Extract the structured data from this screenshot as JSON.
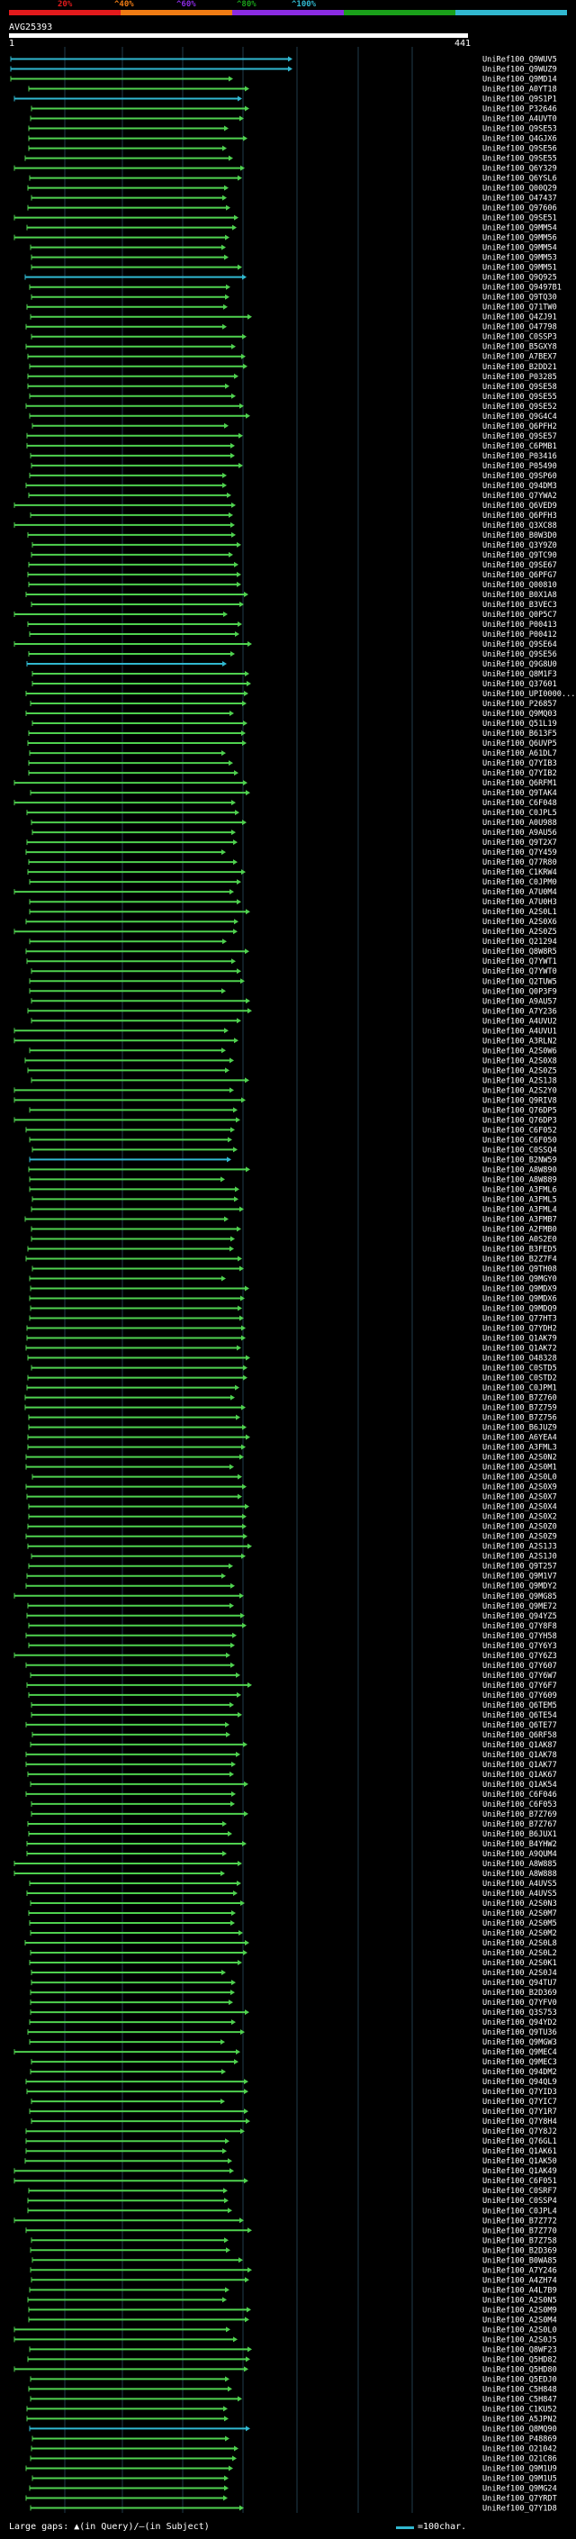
{
  "header": {
    "percent_ticks": [
      "20%",
      "^40%",
      "^60%",
      "^80%",
      "^100%"
    ],
    "bar_colors": [
      "#e31a1c",
      "#f07c14",
      "#8a2be2",
      "#1aa01a",
      "#31b8d0"
    ],
    "query_id": "AVG25393",
    "scale_start": "1",
    "scale_end": "441"
  },
  "colors": {
    "hit_green": "#4fd14f",
    "hit_cyan": "#31b8d0",
    "grid": "#1f3c4d",
    "gap": "#2a7a2a"
  },
  "hits": [
    {
      "id": "UniRef100_Q9WUV5",
      "color": "cyan"
    },
    {
      "id": "UniRef100_Q9WUZ9",
      "color": "cyan"
    },
    {
      "id": "UniRef100_Q9MD14",
      "color": "green"
    },
    {
      "id": "UniRef100_A0YT18",
      "color": "green"
    },
    {
      "id": "UniRef100_Q9S1P1",
      "color": "cyan"
    },
    {
      "id": "UniRef100_P32646",
      "color": "green"
    },
    {
      "id": "UniRef100_A4UVT0",
      "color": "green"
    },
    {
      "id": "UniRef100_Q9SE53",
      "color": "green"
    },
    {
      "id": "UniRef100_Q4GJX6",
      "color": "green"
    },
    {
      "id": "UniRef100_Q9SE56",
      "color": "green"
    },
    {
      "id": "UniRef100_Q9SE55",
      "color": "green"
    },
    {
      "id": "UniRef100_Q6Y329",
      "color": "green"
    },
    {
      "id": "UniRef100_Q6YSL6",
      "color": "green"
    },
    {
      "id": "UniRef100_Q00Q29",
      "color": "green"
    },
    {
      "id": "UniRef100_O47437",
      "color": "green"
    },
    {
      "id": "UniRef100_Q97606",
      "color": "green"
    },
    {
      "id": "UniRef100_Q9SE51",
      "color": "green"
    },
    {
      "id": "UniRef100_Q9MM54",
      "color": "green"
    },
    {
      "id": "UniRef100_Q9MM56",
      "color": "green"
    },
    {
      "id": "UniRef100_Q9MM54",
      "color": "green"
    },
    {
      "id": "UniRef100_Q9MM53",
      "color": "green"
    },
    {
      "id": "UniRef100_Q9MM51",
      "color": "green"
    },
    {
      "id": "UniRef100_Q9Q925",
      "color": "cyan"
    },
    {
      "id": "UniRef100_Q9497B1",
      "color": "green"
    },
    {
      "id": "UniRef100_Q9TQ30",
      "color": "green"
    },
    {
      "id": "UniRef100_Q71TW0",
      "color": "green"
    },
    {
      "id": "UniRef100_Q4ZJ91",
      "color": "green"
    },
    {
      "id": "UniRef100_O47798",
      "color": "green"
    },
    {
      "id": "UniRef100_C0SSP3",
      "color": "green"
    },
    {
      "id": "UniRef100_B5GXY8",
      "color": "green"
    },
    {
      "id": "UniRef100_A7BEX7",
      "color": "green"
    },
    {
      "id": "UniRef100_B2DD21",
      "color": "green"
    },
    {
      "id": "UniRef100_P03285",
      "color": "green"
    },
    {
      "id": "UniRef100_Q9SE58",
      "color": "green"
    },
    {
      "id": "UniRef100_Q9SE55",
      "color": "green"
    },
    {
      "id": "UniRef100_Q9SE52",
      "color": "green"
    },
    {
      "id": "UniRef100_Q9G4C4",
      "color": "green"
    },
    {
      "id": "UniRef100_Q6PFH2",
      "color": "green"
    },
    {
      "id": "UniRef100_Q9SE57",
      "color": "green"
    },
    {
      "id": "UniRef100_C6PMB1",
      "color": "green"
    },
    {
      "id": "UniRef100_P03416",
      "color": "green"
    },
    {
      "id": "UniRef100_P05490",
      "color": "green"
    },
    {
      "id": "UniRef100_Q9SP60",
      "color": "green"
    },
    {
      "id": "UniRef100_Q94DM3",
      "color": "green"
    },
    {
      "id": "UniRef100_Q7YWA2",
      "color": "green"
    },
    {
      "id": "UniRef100_Q6VED9",
      "color": "green"
    },
    {
      "id": "UniRef100_Q6PFH3",
      "color": "green"
    },
    {
      "id": "UniRef100_Q3XC88",
      "color": "green"
    },
    {
      "id": "UniRef100_B0W3D0",
      "color": "green"
    },
    {
      "id": "UniRef100_Q3Y9Z0",
      "color": "green"
    },
    {
      "id": "UniRef100_Q9TC90",
      "color": "green"
    },
    {
      "id": "UniRef100_Q9SE67",
      "color": "green"
    },
    {
      "id": "UniRef100_Q6PFG7",
      "color": "green"
    },
    {
      "id": "UniRef100_Q00810",
      "color": "green"
    },
    {
      "id": "UniRef100_B0X1A8",
      "color": "green"
    },
    {
      "id": "UniRef100_B3VEC3",
      "color": "green"
    },
    {
      "id": "UniRef100_Q0P5C7",
      "color": "green"
    },
    {
      "id": "UniRef100_P00413",
      "color": "green"
    },
    {
      "id": "UniRef100_P00412",
      "color": "green"
    },
    {
      "id": "UniRef100_Q9SE64",
      "color": "green"
    },
    {
      "id": "UniRef100_Q9SE56",
      "color": "green"
    },
    {
      "id": "UniRef100_Q9G8U0",
      "color": "cyan"
    },
    {
      "id": "UniRef100_Q8M1F3",
      "color": "green"
    },
    {
      "id": "UniRef100_Q37601",
      "color": "green"
    },
    {
      "id": "UniRef100_UPI0000...",
      "color": "green"
    },
    {
      "id": "UniRef100_P26857",
      "color": "green"
    },
    {
      "id": "UniRef100_Q9MQ03",
      "color": "green"
    },
    {
      "id": "UniRef100_Q51L19",
      "color": "green"
    },
    {
      "id": "UniRef100_B613F5",
      "color": "green"
    },
    {
      "id": "UniRef100_Q6UVP5",
      "color": "green"
    },
    {
      "id": "UniRef100_A61DL7",
      "color": "green"
    },
    {
      "id": "UniRef100_Q7YIB3",
      "color": "green"
    },
    {
      "id": "UniRef100_Q7YIB2",
      "color": "green"
    },
    {
      "id": "UniRef100_Q6RFM1",
      "color": "green"
    },
    {
      "id": "UniRef100_Q9TAK4",
      "color": "green"
    },
    {
      "id": "UniRef100_C6F048",
      "color": "green"
    },
    {
      "id": "UniRef100_C0JPL5",
      "color": "green"
    },
    {
      "id": "UniRef100_A0U988",
      "color": "green"
    },
    {
      "id": "UniRef100_A9AU56",
      "color": "green"
    },
    {
      "id": "UniRef100_Q9T2X7",
      "color": "green"
    },
    {
      "id": "UniRef100_Q7Y459",
      "color": "green"
    },
    {
      "id": "UniRef100_Q77R80",
      "color": "green"
    },
    {
      "id": "UniRef100_C1KRW4",
      "color": "green"
    },
    {
      "id": "UniRef100_C0JPM0",
      "color": "green"
    },
    {
      "id": "UniRef100_A7U0M4",
      "color": "green"
    },
    {
      "id": "UniRef100_A7U0H3",
      "color": "green"
    },
    {
      "id": "UniRef100_A2S0L1",
      "color": "green"
    },
    {
      "id": "UniRef100_A2S0X6",
      "color": "green"
    },
    {
      "id": "UniRef100_A2S0Z5",
      "color": "green"
    },
    {
      "id": "UniRef100_Q21294",
      "color": "green"
    },
    {
      "id": "UniRef100_Q8W8R5",
      "color": "green"
    },
    {
      "id": "UniRef100_Q7YWT1",
      "color": "green"
    },
    {
      "id": "UniRef100_Q7YWT0",
      "color": "green"
    },
    {
      "id": "UniRef100_Q2TUW5",
      "color": "green"
    },
    {
      "id": "UniRef100_Q0P3F9",
      "color": "green"
    },
    {
      "id": "UniRef100_A9AU57",
      "color": "green"
    },
    {
      "id": "UniRef100_A7Y236",
      "color": "green"
    },
    {
      "id": "UniRef100_A4UVU2",
      "color": "green"
    },
    {
      "id": "UniRef100_A4UVU1",
      "color": "green"
    },
    {
      "id": "UniRef100_A3RLN2",
      "color": "green"
    },
    {
      "id": "UniRef100_A2S0W6",
      "color": "green"
    },
    {
      "id": "UniRef100_A2S0X8",
      "color": "green"
    },
    {
      "id": "UniRef100_A2S0Z5",
      "color": "green"
    },
    {
      "id": "UniRef100_A2S1J8",
      "color": "green"
    },
    {
      "id": "UniRef100_A2S2Y0",
      "color": "green"
    },
    {
      "id": "UniRef100_Q9RIV8",
      "color": "green"
    },
    {
      "id": "UniRef100_Q76DP5",
      "color": "green"
    },
    {
      "id": "UniRef100_Q76DP3",
      "color": "green"
    },
    {
      "id": "UniRef100_C6F052",
      "color": "green"
    },
    {
      "id": "UniRef100_C6F050",
      "color": "green"
    },
    {
      "id": "UniRef100_C0SSQ4",
      "color": "green"
    },
    {
      "id": "UniRef100_B2NW59",
      "color": "cyan"
    },
    {
      "id": "UniRef100_A8W890",
      "color": "green"
    },
    {
      "id": "UniRef100_A8W889",
      "color": "green"
    },
    {
      "id": "UniRef100_A3FML6",
      "color": "green"
    },
    {
      "id": "UniRef100_A3FML5",
      "color": "green"
    },
    {
      "id": "UniRef100_A3FML4",
      "color": "green"
    },
    {
      "id": "UniRef100_A3FMB7",
      "color": "green"
    },
    {
      "id": "UniRef100_A2FMB0",
      "color": "green"
    },
    {
      "id": "UniRef100_A0S2E0",
      "color": "green"
    },
    {
      "id": "UniRef100_B3FED5",
      "color": "green"
    },
    {
      "id": "UniRef100_B2Z7F4",
      "color": "green"
    },
    {
      "id": "UniRef100_Q9TH08",
      "color": "green"
    },
    {
      "id": "UniRef100_Q9MGY0",
      "color": "green"
    },
    {
      "id": "UniRef100_Q9MDX9",
      "color": "green"
    },
    {
      "id": "UniRef100_Q9MDX6",
      "color": "green"
    },
    {
      "id": "UniRef100_Q9MDQ9",
      "color": "green"
    },
    {
      "id": "UniRef100_Q77HT3",
      "color": "green"
    },
    {
      "id": "UniRef100_Q7YDH2",
      "color": "green"
    },
    {
      "id": "UniRef100_Q1AK79",
      "color": "green"
    },
    {
      "id": "UniRef100_Q1AK72",
      "color": "green"
    },
    {
      "id": "UniRef100_O48328",
      "color": "green"
    },
    {
      "id": "UniRef100_C0STD5",
      "color": "green"
    },
    {
      "id": "UniRef100_C0STD2",
      "color": "green"
    },
    {
      "id": "UniRef100_C0JPM1",
      "color": "green"
    },
    {
      "id": "UniRef100_B7Z760",
      "color": "green"
    },
    {
      "id": "UniRef100_B7Z759",
      "color": "green"
    },
    {
      "id": "UniRef100_B7Z756",
      "color": "green"
    },
    {
      "id": "UniRef100_B6JUZ9",
      "color": "green"
    },
    {
      "id": "UniRef100_A6YEA4",
      "color": "green"
    },
    {
      "id": "UniRef100_A3FML3",
      "color": "green"
    },
    {
      "id": "UniRef100_A2S0N2",
      "color": "green"
    },
    {
      "id": "UniRef100_A2S0M1",
      "color": "green"
    },
    {
      "id": "UniRef100_A2S0L0",
      "color": "green"
    },
    {
      "id": "UniRef100_A2S0X9",
      "color": "green"
    },
    {
      "id": "UniRef100_A2S0X7",
      "color": "green"
    },
    {
      "id": "UniRef100_A2S0X4",
      "color": "green"
    },
    {
      "id": "UniRef100_A2S0X2",
      "color": "green"
    },
    {
      "id": "UniRef100_A2S0Z0",
      "color": "green"
    },
    {
      "id": "UniRef100_A2S0Z9",
      "color": "green"
    },
    {
      "id": "UniRef100_A2S1J3",
      "color": "green"
    },
    {
      "id": "UniRef100_A2S1J0",
      "color": "green"
    },
    {
      "id": "UniRef100_Q9T257",
      "color": "green"
    },
    {
      "id": "UniRef100_Q9M1V7",
      "color": "green"
    },
    {
      "id": "UniRef100_Q9MDY2",
      "color": "green"
    },
    {
      "id": "UniRef100_Q9MG85",
      "color": "green"
    },
    {
      "id": "UniRef100_Q9ME72",
      "color": "green"
    },
    {
      "id": "UniRef100_Q94YZ5",
      "color": "green"
    },
    {
      "id": "UniRef100_Q7Y8F8",
      "color": "green"
    },
    {
      "id": "UniRef100_Q7YH58",
      "color": "green"
    },
    {
      "id": "UniRef100_Q7Y6Y3",
      "color": "green"
    },
    {
      "id": "UniRef100_Q7Y6Z3",
      "color": "green"
    },
    {
      "id": "UniRef100_Q7Y607",
      "color": "green"
    },
    {
      "id": "UniRef100_Q7Y6W7",
      "color": "green"
    },
    {
      "id": "UniRef100_Q7Y6F7",
      "color": "green"
    },
    {
      "id": "UniRef100_Q7Y609",
      "color": "green"
    },
    {
      "id": "UniRef100_Q6TEM5",
      "color": "green"
    },
    {
      "id": "UniRef100_Q6TE54",
      "color": "green"
    },
    {
      "id": "UniRef100_Q6TE77",
      "color": "green"
    },
    {
      "id": "UniRef100_Q6RF58",
      "color": "green"
    },
    {
      "id": "UniRef100_Q1AK87",
      "color": "green"
    },
    {
      "id": "UniRef100_Q1AK78",
      "color": "green"
    },
    {
      "id": "UniRef100_Q1AK77",
      "color": "green"
    },
    {
      "id": "UniRef100_Q1AK67",
      "color": "green"
    },
    {
      "id": "UniRef100_Q1AK54",
      "color": "green"
    },
    {
      "id": "UniRef100_C6F046",
      "color": "green"
    },
    {
      "id": "UniRef100_C6F053",
      "color": "green"
    },
    {
      "id": "UniRef100_B7Z769",
      "color": "green"
    },
    {
      "id": "UniRef100_B7Z767",
      "color": "green"
    },
    {
      "id": "UniRef100_B6JUX1",
      "color": "green"
    },
    {
      "id": "UniRef100_B4YHW2",
      "color": "green"
    },
    {
      "id": "UniRef100_A9QUM4",
      "color": "green"
    },
    {
      "id": "UniRef100_A8W885",
      "color": "green"
    },
    {
      "id": "UniRef100_A8W888",
      "color": "green"
    },
    {
      "id": "UniRef100_A4UVS5",
      "color": "green"
    },
    {
      "id": "UniRef100_A4UVS5",
      "color": "green"
    },
    {
      "id": "UniRef100_A2S0N3",
      "color": "green"
    },
    {
      "id": "UniRef100_A2S0M7",
      "color": "green"
    },
    {
      "id": "UniRef100_A2S0M5",
      "color": "green"
    },
    {
      "id": "UniRef100_A2S0M2",
      "color": "green"
    },
    {
      "id": "UniRef100_A2S0L8",
      "color": "green"
    },
    {
      "id": "UniRef100_A2S0L2",
      "color": "green"
    },
    {
      "id": "UniRef100_A2S0K1",
      "color": "green"
    },
    {
      "id": "UniRef100_A2S0J4",
      "color": "green"
    },
    {
      "id": "UniRef100_Q94TU7",
      "color": "green"
    },
    {
      "id": "UniRef100_B2D369",
      "color": "green"
    },
    {
      "id": "UniRef100_Q7YFV0",
      "color": "green"
    },
    {
      "id": "UniRef100_Q3S753",
      "color": "green"
    },
    {
      "id": "UniRef100_Q94YD2",
      "color": "green"
    },
    {
      "id": "UniRef100_Q9TU36",
      "color": "green"
    },
    {
      "id": "UniRef100_Q9MGW3",
      "color": "green"
    },
    {
      "id": "UniRef100_Q9MEC4",
      "color": "green"
    },
    {
      "id": "UniRef100_Q9MEC3",
      "color": "green"
    },
    {
      "id": "UniRef100_Q94DM2",
      "color": "green"
    },
    {
      "id": "UniRef100_Q94QL9",
      "color": "green"
    },
    {
      "id": "UniRef100_Q7YID3",
      "color": "green"
    },
    {
      "id": "UniRef100_Q7YIC7",
      "color": "green"
    },
    {
      "id": "UniRef100_Q7Y1R7",
      "color": "green"
    },
    {
      "id": "UniRef100_Q7Y8H4",
      "color": "green"
    },
    {
      "id": "UniRef100_Q7Y8J2",
      "color": "green"
    },
    {
      "id": "UniRef100_Q76GL1",
      "color": "green"
    },
    {
      "id": "UniRef100_Q1AK61",
      "color": "green"
    },
    {
      "id": "UniRef100_Q1AK50",
      "color": "green"
    },
    {
      "id": "UniRef100_Q1AK49",
      "color": "green"
    },
    {
      "id": "UniRef100_C6F051",
      "color": "green"
    },
    {
      "id": "UniRef100_C0SRF7",
      "color": "green"
    },
    {
      "id": "UniRef100_C0SSP4",
      "color": "green"
    },
    {
      "id": "UniRef100_C0JPL4",
      "color": "green"
    },
    {
      "id": "UniRef100_B7Z772",
      "color": "green"
    },
    {
      "id": "UniRef100_B7Z770",
      "color": "green"
    },
    {
      "id": "UniRef100_B7Z758",
      "color": "green"
    },
    {
      "id": "UniRef100_B2D369",
      "color": "green"
    },
    {
      "id": "UniRef100_B0WA85",
      "color": "green"
    },
    {
      "id": "UniRef100_A7Y246",
      "color": "green"
    },
    {
      "id": "UniRef100_A4ZH74",
      "color": "green"
    },
    {
      "id": "UniRef100_A4L7B9",
      "color": "green"
    },
    {
      "id": "UniRef100_A2S0N5",
      "color": "green"
    },
    {
      "id": "UniRef100_A2S0M9",
      "color": "green"
    },
    {
      "id": "UniRef100_A2S0M4",
      "color": "green"
    },
    {
      "id": "UniRef100_A2S0L0",
      "color": "green"
    },
    {
      "id": "UniRef100_A2S0J5",
      "color": "green"
    },
    {
      "id": "UniRef100_Q8WF23",
      "color": "green"
    },
    {
      "id": "UniRef100_Q5HD82",
      "color": "green"
    },
    {
      "id": "UniRef100_Q5HD80",
      "color": "green"
    },
    {
      "id": "UniRef100_Q5EDJ0",
      "color": "green"
    },
    {
      "id": "UniRef100_C5H848",
      "color": "green"
    },
    {
      "id": "UniRef100_C5H847",
      "color": "green"
    },
    {
      "id": "UniRef100_C1KU52",
      "color": "green"
    },
    {
      "id": "UniRef100_A5JPN2",
      "color": "green"
    },
    {
      "id": "UniRef100_Q8MQ90",
      "color": "cyan"
    },
    {
      "id": "UniRef100_P48869",
      "color": "green"
    },
    {
      "id": "UniRef100_O21042",
      "color": "green"
    },
    {
      "id": "UniRef100_O21C86",
      "color": "green"
    },
    {
      "id": "UniRef100_Q9M1U9",
      "color": "green"
    },
    {
      "id": "UniRef100_Q9M1U5",
      "color": "green"
    },
    {
      "id": "UniRef100_Q9MG24",
      "color": "green"
    },
    {
      "id": "UniRef100_Q7YRDT",
      "color": "green"
    },
    {
      "id": "UniRef100_Q7Y1D8",
      "color": "green"
    }
  ],
  "footer": {
    "gap_legend": "Large gaps: ▲(in Query)/—(in Subject)",
    "scale_legend": "=100char."
  }
}
